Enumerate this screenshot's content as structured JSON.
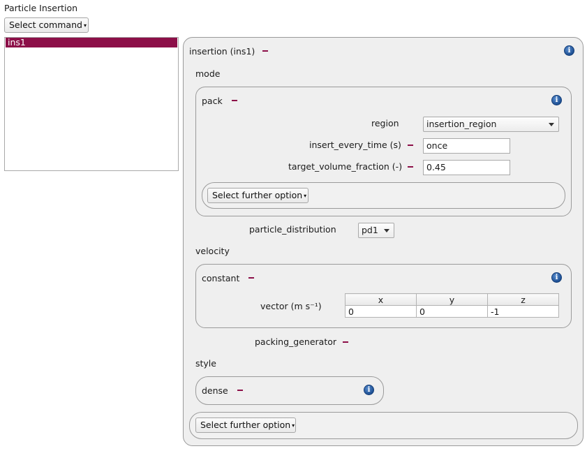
{
  "window": {
    "title": "Particle Insertion"
  },
  "toolbar": {
    "select_command": "Select command"
  },
  "command_list": {
    "items": [
      "ins1"
    ]
  },
  "insertion": {
    "title": "insertion (ins1)",
    "mode_label": "mode",
    "pack": {
      "title": "pack",
      "region_label": "region",
      "region_value": "insertion_region",
      "insert_every_time_label": "insert_every_time (s)",
      "insert_every_time_value": "once",
      "target_volume_fraction_label": "target_volume_fraction (-)",
      "target_volume_fraction_value": "0.45",
      "further_option": "Select further option"
    },
    "particle_distribution_label": "particle_distribution",
    "particle_distribution_value": "pd1",
    "velocity_label": "velocity",
    "constant": {
      "title": "constant",
      "vector_label": "vector (m s⁻¹)",
      "columns": [
        "x",
        "y",
        "z"
      ],
      "values": [
        "0",
        "0",
        "-1"
      ]
    },
    "packing_generator_label": "packing_generator",
    "style_label": "style",
    "dense": {
      "title": "dense"
    },
    "further_option": "Select further option"
  },
  "icons": {
    "info": "i"
  }
}
